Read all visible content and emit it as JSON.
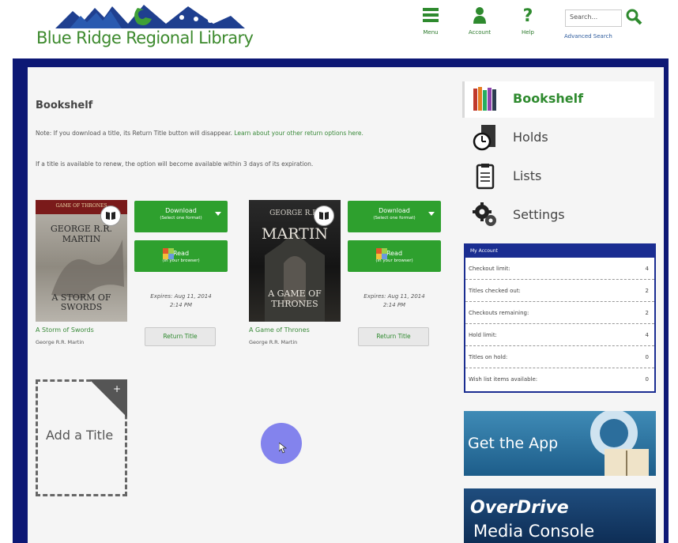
{
  "header": {
    "logo_text": "Blue Ridge Regional Library",
    "nav": [
      {
        "label": "Menu",
        "icon": "hamburger-menu-icon"
      },
      {
        "label": "Account",
        "icon": "person-icon"
      },
      {
        "label": "Help",
        "icon": "question-mark-icon"
      }
    ],
    "search_placeholder": "Search...",
    "advanced_search": "Advanced Search",
    "brand_color": "#3d8a2e",
    "frame_color": "#0d1875"
  },
  "main": {
    "title": "Bookshelf",
    "note_prefix": "Note: If you download a title, its Return Title button will disappear. ",
    "note_link": "Learn about your other return options here.",
    "renew_note": "If a title is available to renew, the option will become available within 3 days of its expiration.",
    "books": [
      {
        "title": "A Storm of Swords",
        "author": "George R.R. Martin",
        "cover_top": "GAME OF THRONES",
        "cover_author": "GEORGE R.R. MARTIN",
        "cover_title": "A STORM OF SWORDS",
        "download_label": "Download",
        "download_sub": "(Select one format)",
        "read_label": "Read",
        "read_sub": "(In your browser)",
        "expires_line1": "Expires: Aug 11, 2014",
        "expires_line2": "2:14 PM",
        "return_label": "Return Title"
      },
      {
        "title": "A Game of Thrones",
        "author": "George R.R. Martin",
        "cover_top": "GEORGE R.R.",
        "cover_author": "MARTIN",
        "cover_title": "A GAME OF THRONES",
        "download_label": "Download",
        "download_sub": "(Select one format)",
        "read_label": "Read",
        "read_sub": "(In your browser)",
        "expires_line1": "Expires: Aug 11, 2014",
        "expires_line2": "2:14 PM",
        "return_label": "Return Title"
      }
    ],
    "add_title": "Add a Title",
    "accent_color": "#2ea02e"
  },
  "sidebar": {
    "items": [
      {
        "label": "Bookshelf",
        "icon": "books-icon",
        "active": true
      },
      {
        "label": "Holds",
        "icon": "stopwatch-icon",
        "active": false
      },
      {
        "label": "Lists",
        "icon": "clipboard-icon",
        "active": false
      },
      {
        "label": "Settings",
        "icon": "gears-icon",
        "active": false
      }
    ],
    "account": {
      "heading": "My Account",
      "rows": [
        {
          "label": "Checkout limit:",
          "value": "4"
        },
        {
          "label": "Titles checked out:",
          "value": "2"
        },
        {
          "label": "Checkouts remaining:",
          "value": "2"
        },
        {
          "label": "Hold limit:",
          "value": "4"
        },
        {
          "label": "Titles on hold:",
          "value": "0"
        },
        {
          "label": "Wish list items available:",
          "value": "0"
        }
      ]
    },
    "get_app": "Get the App",
    "overdrive_1": "OverDrive",
    "overdrive_2": "Media Console"
  }
}
